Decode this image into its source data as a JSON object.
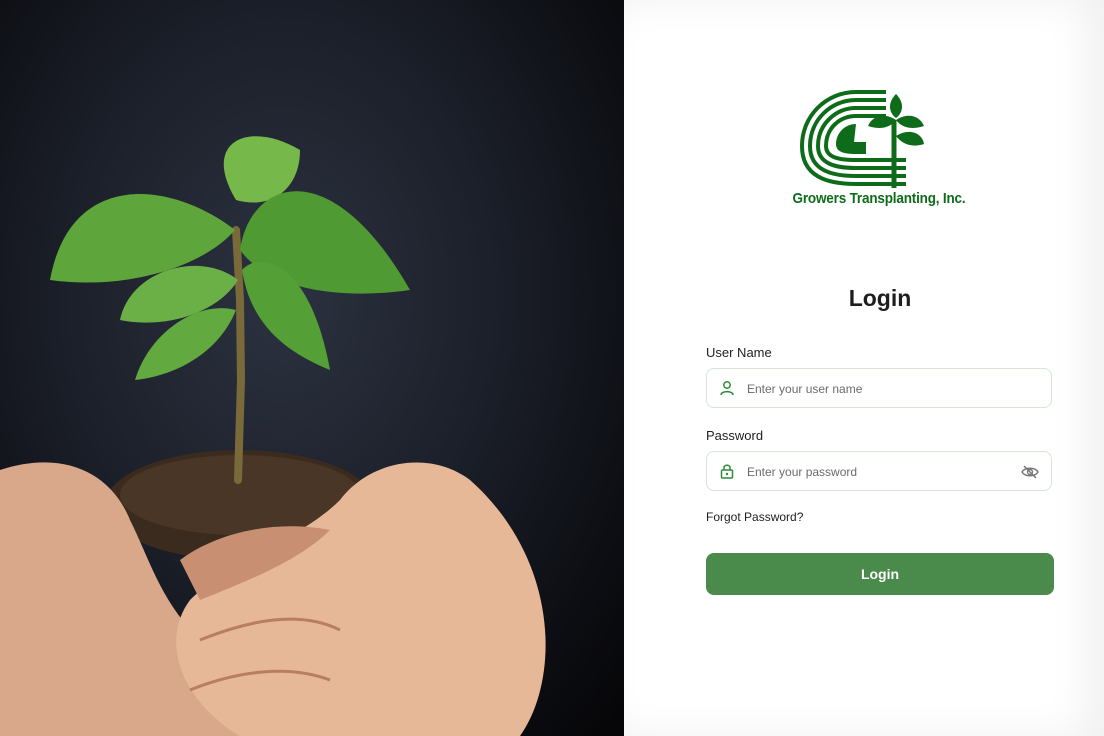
{
  "brand": {
    "name": "Growers Transplanting, Inc.",
    "color": "#0e6b1a"
  },
  "login": {
    "title": "Login",
    "username_label": "User Name",
    "username_placeholder": "Enter your user name",
    "password_label": "Password",
    "password_placeholder": "Enter your password",
    "forgot_password": "Forgot Password?",
    "submit_label": "Login",
    "button_color": "#4a8a4b"
  },
  "icons": {
    "user": "user-icon",
    "lock": "lock-icon",
    "visibility": "eye-off-icon"
  }
}
